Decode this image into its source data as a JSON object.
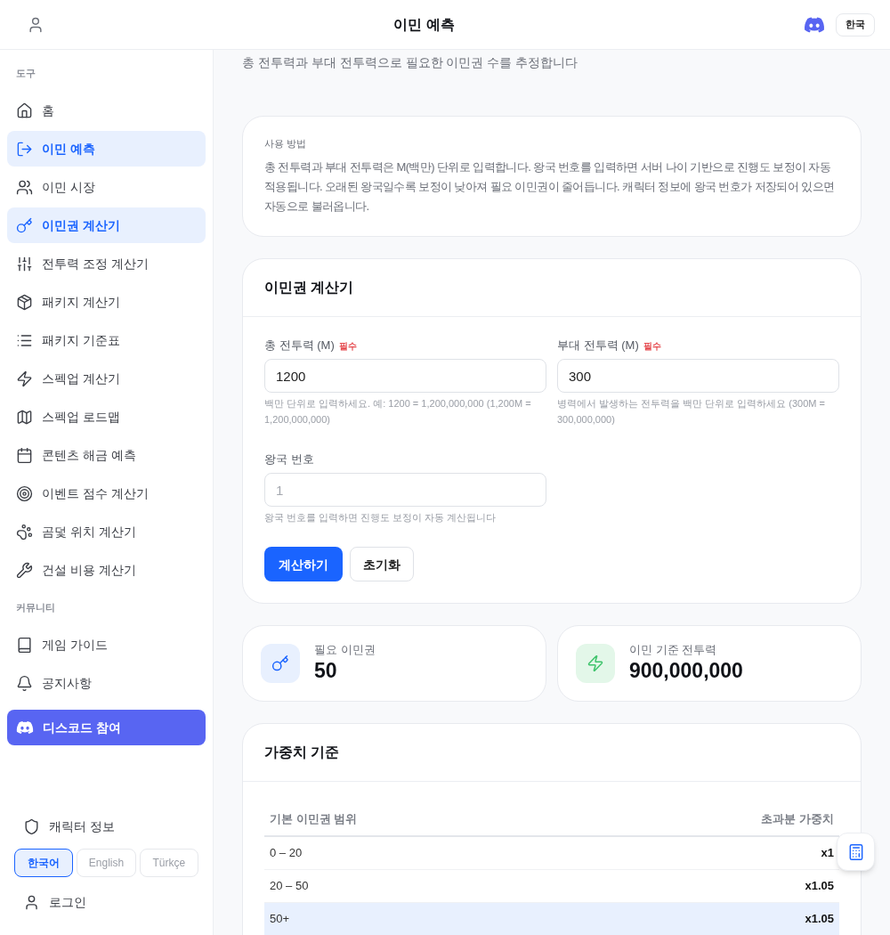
{
  "header": {
    "title": "이민 예측",
    "language_button": "한국"
  },
  "sidebar": {
    "sections": [
      {
        "title": "도구",
        "items": [
          {
            "label": "홈",
            "selected": false
          },
          {
            "label": "이민 예측",
            "selected": true
          },
          {
            "label": "이민 시장",
            "selected": false
          },
          {
            "label": "이민권 계산기",
            "selected": true
          },
          {
            "label": "전투력 조정 계산기",
            "selected": false
          },
          {
            "label": "패키지 계산기",
            "selected": false
          },
          {
            "label": "패키지 기준표",
            "selected": false
          },
          {
            "label": "스펙업 계산기",
            "selected": false
          },
          {
            "label": "스펙업 로드맵",
            "selected": false
          },
          {
            "label": "콘텐츠 해금 예측",
            "selected": false
          },
          {
            "label": "이벤트 점수 계산기",
            "selected": false
          },
          {
            "label": "곰덫 위치 계산기",
            "selected": false
          },
          {
            "label": "건설 비용 계산기",
            "selected": false
          }
        ]
      },
      {
        "title": "커뮤니티",
        "items": [
          {
            "label": "게임 가이드",
            "selected": false
          },
          {
            "label": "공지사항",
            "selected": false
          }
        ]
      }
    ],
    "discord_button": "디스코드 참여",
    "character_info": "캐릭터 정보",
    "languages": [
      {
        "label": "한국어",
        "selected": true
      },
      {
        "label": "English",
        "selected": false
      },
      {
        "label": "Türkçe",
        "selected": false
      }
    ],
    "login": "로그인"
  },
  "subtitle": "총 전투력과 부대 전투력으로 필요한 이민권 수를 추정합니다",
  "usage_card": {
    "title": "사용 방법",
    "text": "총 전투력과 부대 전투력은 M(백만) 단위로 입력합니다. 왕국 번호를 입력하면 서버 나이 기반으로 진행도 보정이 자동 적용됩니다. 오래된 왕국일수록 보정이 낮아져 필요 이민권이 줄어듭니다. 캐릭터 정보에 왕국 번호가 저장되어 있으면 자동으로 불러옵니다."
  },
  "calculator": {
    "title": "이민권 계산기",
    "fields": [
      {
        "label": "총 전투력 (M)",
        "badge": "필수",
        "value": "1200",
        "hint": "백만 단위로 입력하세요. 예: 1200 = 1,200,000,000 (1,200M = 1,200,000,000)"
      },
      {
        "label": "부대 전투력 (M)",
        "badge": "필수",
        "value": "300",
        "hint": "병력에서 발생하는 전투력을 백만 단위로 입력하세요 (300M = 300,000,000)"
      },
      {
        "label": "왕국 번호",
        "placeholder": "1",
        "hint": "왕국 번호를 입력하면 진행도 보정이 자동 계산됩니다"
      }
    ],
    "buttons": [
      {
        "label": "계산하기",
        "kind": "primary"
      },
      {
        "label": "초기화",
        "kind": "secondary"
      }
    ]
  },
  "stats": [
    {
      "label": "필요 이민권",
      "value": "50"
    },
    {
      "label": "이민 기준 전투력",
      "value": "900,000,000"
    }
  ],
  "weights": {
    "title": "가중치 기준",
    "columns": [
      "기본 이민권 범위",
      "초과분 가중치"
    ],
    "rows": [
      {
        "range": "0 – 20",
        "weight": "x1",
        "highlighted": false
      },
      {
        "range": "20 – 50",
        "weight": "x1.05",
        "highlighted": false
      },
      {
        "range": "50+",
        "weight": "x1.05",
        "highlighted": true
      }
    ]
  }
}
